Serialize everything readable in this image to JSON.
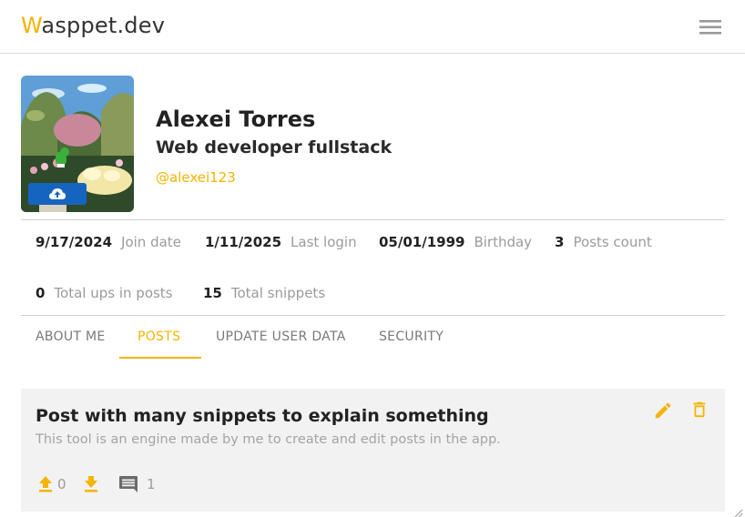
{
  "header": {
    "brand_first": "W",
    "brand_rest": "asppet.dev",
    "menu_icon": "hamburger-menu-icon"
  },
  "profile": {
    "name": "Alexei Torres",
    "role": "Web developer fullstack",
    "handle": "@alexei123",
    "avatar_upload_icon": "cloud-upload-icon"
  },
  "stats": [
    {
      "value": "9/17/2024",
      "label": "Join date"
    },
    {
      "value": "1/11/2025",
      "label": "Last login"
    },
    {
      "value": "05/01/1999",
      "label": "Birthday"
    },
    {
      "value": "3",
      "label": "Posts count"
    },
    {
      "value": "0",
      "label": "Total ups in posts"
    },
    {
      "value": "15",
      "label": "Total snippets"
    }
  ],
  "tabs": [
    {
      "label": "ABOUT ME",
      "active": false
    },
    {
      "label": "POSTS",
      "active": true
    },
    {
      "label": "UPDATE USER DATA",
      "active": false
    },
    {
      "label": "SECURITY",
      "active": false
    }
  ],
  "post": {
    "title": "Post with many snippets to explain something",
    "description": "This tool is an engine made by me to create and edit posts in the app.",
    "ups": "0",
    "comments": "1",
    "icons": [
      "edit-icon",
      "delete-icon",
      "upvote-icon",
      "downvote-icon",
      "comment-icon"
    ]
  },
  "colors": {
    "accent": "#f5b400",
    "upload_button": "#1565c0",
    "card_background": "#f2f2f2"
  }
}
